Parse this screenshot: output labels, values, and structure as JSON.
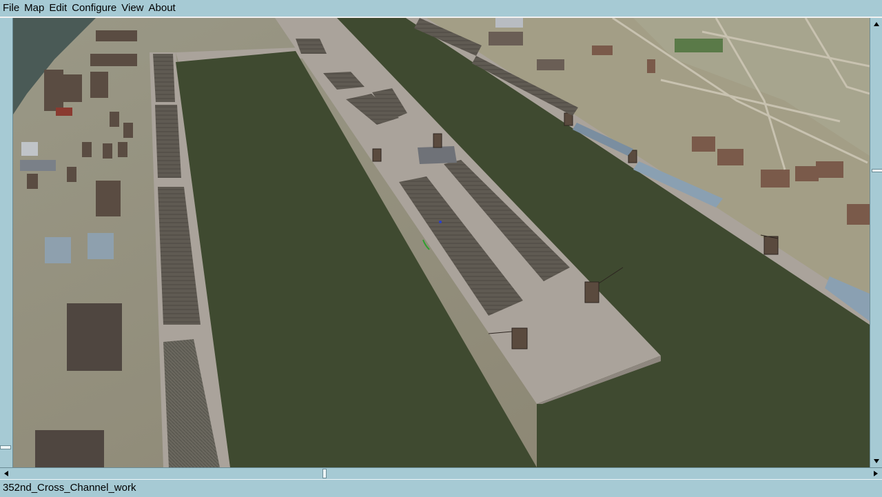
{
  "menu": {
    "items": [
      "File",
      "Map",
      "Edit",
      "Configure",
      "View",
      "About"
    ]
  },
  "status": {
    "text": "352nd_Cross_Channel_work"
  },
  "icons": {
    "scroll_up": "arrow-up-icon",
    "scroll_down": "arrow-down-icon",
    "scroll_left": "arrow-left-icon",
    "scroll_right": "arrow-right-icon"
  },
  "colors": {
    "chrome": "#a6cad4",
    "water": "#3f4a30",
    "quay": "#aba29a",
    "land": "#8f8a78"
  }
}
